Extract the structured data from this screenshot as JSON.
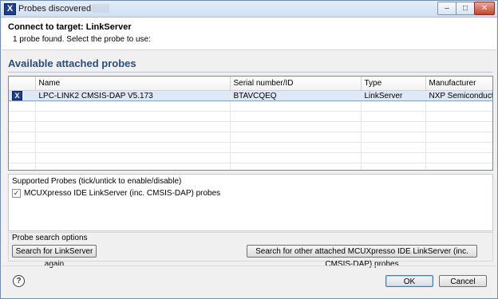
{
  "window": {
    "title": "Probes discovered"
  },
  "header": {
    "title": "Connect to target: LinkServer",
    "subtitle": "1 probe found. Select the probe to use:"
  },
  "section": {
    "title": "Available attached probes"
  },
  "table": {
    "columns": [
      "",
      "Name",
      "Serial number/ID",
      "Type",
      "Manufacturer"
    ],
    "rows": [
      {
        "icon": "X",
        "name": "LPC-LINK2 CMSIS-DAP V5.173",
        "serial": "BTAVCQEQ",
        "type": "LinkServer",
        "manufacturer": "NXP Semiconductors"
      }
    ]
  },
  "supported": {
    "label": "Supported Probes (tick/untick to enable/disable)",
    "items": [
      {
        "label": "MCUXpresso IDE LinkServer (inc. CMSIS-DAP) probes",
        "checked": true
      }
    ]
  },
  "search": {
    "label": "Probe search options",
    "btn_again": "Search for LinkServer again",
    "btn_other": "Search for other attached MCUXpresso IDE LinkServer (inc. CMSIS-DAP) probes"
  },
  "footer": {
    "ok": "OK",
    "cancel": "Cancel",
    "help": "?"
  },
  "colors": {
    "accent": "#2a4d7a",
    "selection": "#dbe9fa"
  }
}
